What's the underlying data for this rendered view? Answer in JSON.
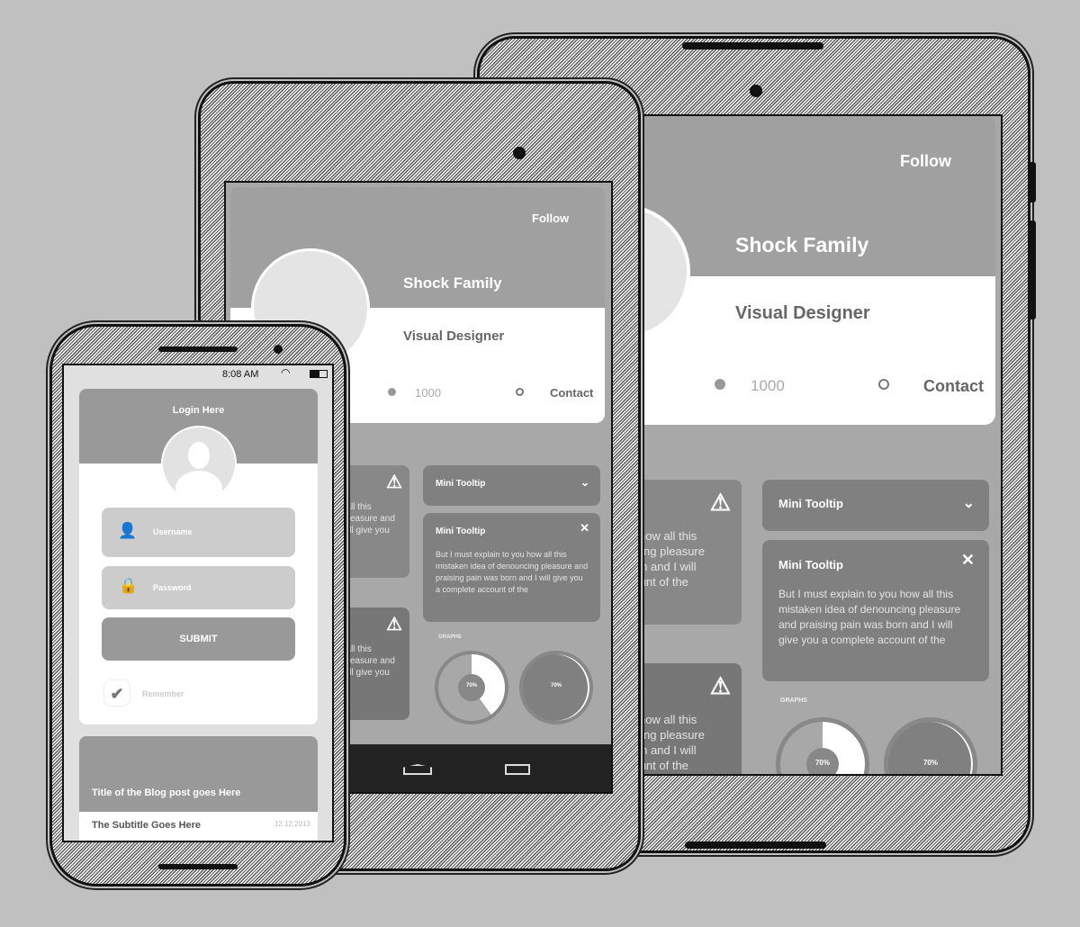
{
  "profile": {
    "follow": "Follow",
    "name": "Shock Family",
    "role": "Visual Designer",
    "followers": "1000",
    "contact": "Contact",
    "facebook_icon": "facebook-icon",
    "mail_icon": "mail-icon"
  },
  "tooltips": {
    "title": "Mini Tooltip",
    "body": "But I must explain to you how all this mistaken idea of denouncing pleasure and praising pain was born and I will give you a complete account of the",
    "line1": "But I must explain to you how all this",
    "line2": "mistaken idea of denouncing pleasure",
    "line3": "and praising pain was born and I will",
    "line4": "give you a complete account of the"
  },
  "graphs": {
    "label": "GRAPHS",
    "value1": "70%",
    "value2": "70%",
    "progress": 70
  },
  "phone": {
    "time": "8:08 AM",
    "login_title": "Login Here",
    "username_placeholder": "Username",
    "password_placeholder": "Password",
    "submit": "SUBMIT",
    "remember": "Remember",
    "remember_checked": true,
    "blog_title": "Title of the Blog post goes Here",
    "blog_subtitle": "The Subtitle Goes Here",
    "blog_date": "12.12.2013"
  },
  "colors": {
    "background": "#c0c0c0",
    "header": "#a0a0a0",
    "card_dark": "#808080",
    "white": "#ffffff"
  }
}
